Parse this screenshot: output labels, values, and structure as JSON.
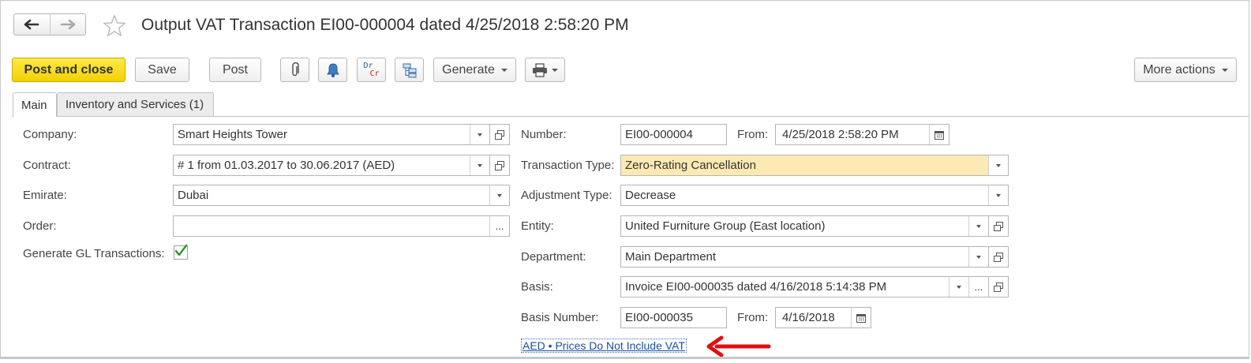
{
  "window": {
    "title": "Output VAT Transaction EI00-000004 dated 4/25/2018 2:58:20 PM"
  },
  "toolbar": {
    "post_and_close": "Post and close",
    "save": "Save",
    "post": "Post",
    "generate": "Generate",
    "more_actions": "More actions",
    "drcr_dr": "Dr",
    "drcr_cr": "Cr"
  },
  "tabs": [
    {
      "label": "Main",
      "active": true
    },
    {
      "label": "Inventory and Services (1)",
      "active": false
    }
  ],
  "form": {
    "company": {
      "label": "Company:",
      "value": "Smart Heights Tower"
    },
    "contract": {
      "label": "Contract:",
      "value": "# 1 from 01.03.2017 to 30.06.2017 (AED)"
    },
    "emirate": {
      "label": "Emirate:",
      "value": "Dubai"
    },
    "order": {
      "label": "Order:",
      "value": ""
    },
    "generate_gl": {
      "label": "Generate GL Transactions:",
      "checked": true
    },
    "number": {
      "label": "Number:",
      "value": "EI00-000004"
    },
    "from": {
      "label": "From:",
      "value": "4/25/2018  2:58:20 PM"
    },
    "transaction_type": {
      "label": "Transaction Type:",
      "value": "Zero-Rating Cancellation"
    },
    "adjustment_type": {
      "label": "Adjustment Type:",
      "value": "Decrease"
    },
    "entity": {
      "label": "Entity:",
      "value": "United Furniture Group (East location)"
    },
    "department": {
      "label": "Department:",
      "value": "Main Department"
    },
    "basis": {
      "label": "Basis:",
      "value": "Invoice EI00-000035 dated 4/16/2018 5:14:38 PM"
    },
    "basis_number": {
      "label": "Basis Number:",
      "value": "EI00-000035"
    },
    "basis_from": {
      "label": "From:",
      "value": "4/16/2018"
    },
    "ellipsis": "..."
  },
  "footer": {
    "prices_link": "AED • Prices Do Not Include VAT"
  },
  "colors": {
    "primary_button": "#f3d100",
    "highlight_field": "#fde9b3",
    "link": "#1a4ea0",
    "arrow": "#e01010",
    "checkmark": "#2e9a2e"
  }
}
